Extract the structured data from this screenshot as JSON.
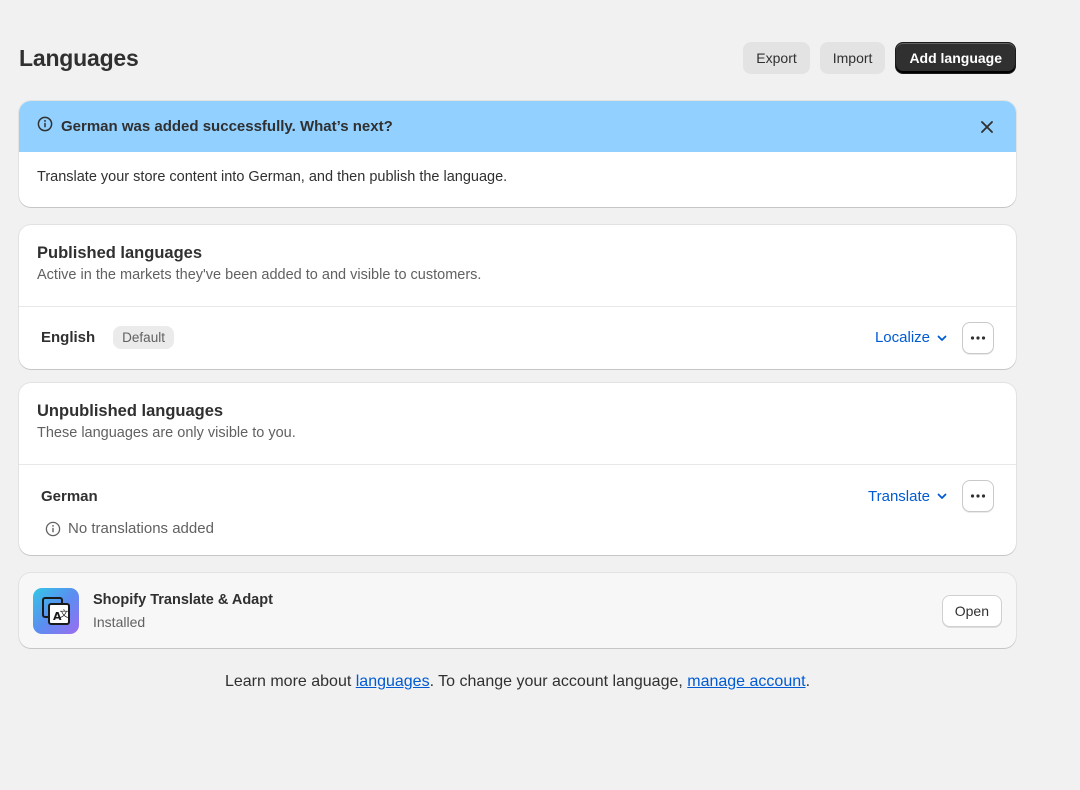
{
  "header": {
    "title": "Languages",
    "export_label": "Export",
    "import_label": "Import",
    "add_label": "Add language"
  },
  "banner": {
    "title": "German was added successfully. What’s next?",
    "body": "Translate your store content into German, and then publish the language.",
    "color": "#91d0ff"
  },
  "published": {
    "title": "Published languages",
    "description": "Active in the markets they've been added to and visible to customers.",
    "languages": [
      {
        "name": "English",
        "badge": "Default",
        "action": "Localize"
      }
    ]
  },
  "unpublished": {
    "title": "Unpublished languages",
    "description": "These languages are only visible to you.",
    "languages": [
      {
        "name": "German",
        "action": "Translate",
        "status": "No translations added"
      }
    ]
  },
  "app": {
    "name": "Shopify Translate & Adapt",
    "status": "Installed",
    "open_label": "Open"
  },
  "footer": {
    "prefix": "Learn more about ",
    "link1": "languages",
    "middle": ". To change your account language, ",
    "link2": "manage account",
    "suffix": "."
  },
  "colors": {
    "accent_link": "#005bd3",
    "primary_button": "#303030",
    "background": "#f1f1f1"
  }
}
